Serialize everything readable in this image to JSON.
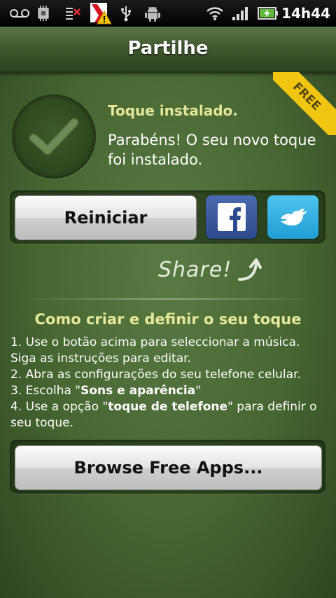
{
  "status_bar": {
    "time": "14h44",
    "icons": [
      "voicemail-icon",
      "settings-chip-icon",
      "signal-off-icon",
      "kaspersky-warning-icon",
      "usb-icon",
      "android-icon",
      "wifi-icon",
      "cell-signal-icon",
      "battery-charging-icon"
    ]
  },
  "header": {
    "title": "Partilhe"
  },
  "ribbon": {
    "label": "FREE",
    "color": "#f1c613"
  },
  "install": {
    "title": "Toque instalado.",
    "message": "Parabéns! O seu novo toque foi instalado."
  },
  "actions": {
    "restart_label": "Reiniciar",
    "facebook_icon": "facebook-icon",
    "twitter_icon": "twitter-bird-icon"
  },
  "share": {
    "label": "Share!"
  },
  "howto": {
    "title": "Como criar e definir o seu toque",
    "steps": [
      {
        "prefix": "1.  Use o botão acima para seleccionar a música. Siga as instruções para editar.",
        "bold": "",
        "suffix": ""
      },
      {
        "prefix": "2.  Abra as configurações do seu telefone celular.",
        "bold": "",
        "suffix": ""
      },
      {
        "prefix": "3.  Escolha \"",
        "bold": "Sons e aparência",
        "suffix": "\""
      },
      {
        "prefix": "4.  Use a opção \"",
        "bold": "toque de telefone",
        "suffix": "\" para definir o seu toque."
      }
    ]
  },
  "browse": {
    "label": "Browse Free Apps..."
  },
  "colors": {
    "accent_text": "#e6e79a",
    "background": "#466531",
    "facebook": "#3b5998",
    "twitter": "#33aee4"
  }
}
